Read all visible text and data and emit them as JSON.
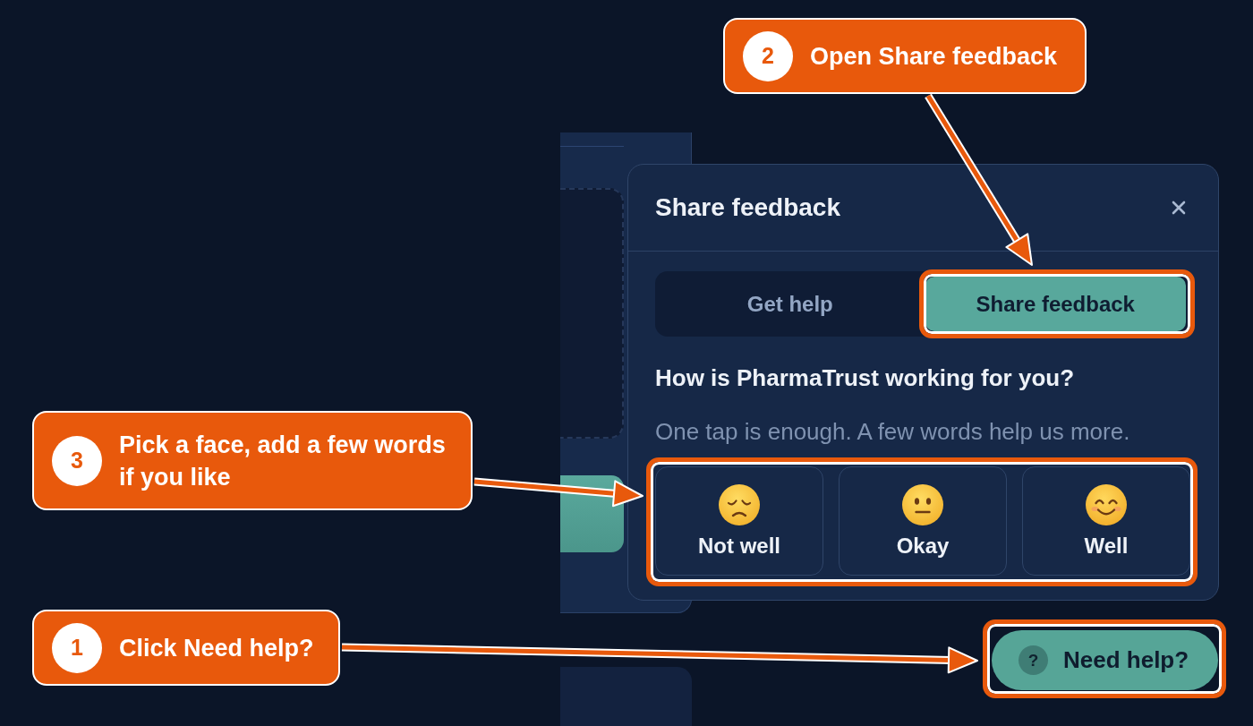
{
  "dialog": {
    "title": "Share feedback",
    "tabs": [
      {
        "label": "Get help",
        "selected": false
      },
      {
        "label": "Share feedback",
        "selected": true
      }
    ],
    "question": "How is PharmaTrust working for you?",
    "hint": "One tap is enough. A few words help us more.",
    "ratings": [
      {
        "kind": "sad",
        "label": "Not well",
        "selected": false
      },
      {
        "kind": "neutral",
        "label": "Okay",
        "selected": false
      },
      {
        "kind": "happy",
        "label": "Well",
        "selected": false
      }
    ]
  },
  "help_button": {
    "badge": "?",
    "label": "Need help?"
  },
  "callouts": [
    {
      "number": "2",
      "text": "Open Share feedback"
    },
    {
      "number": "3",
      "text": "Pick a face, add a few words if you like"
    },
    {
      "number": "1",
      "text": "Click Need help?"
    }
  ]
}
